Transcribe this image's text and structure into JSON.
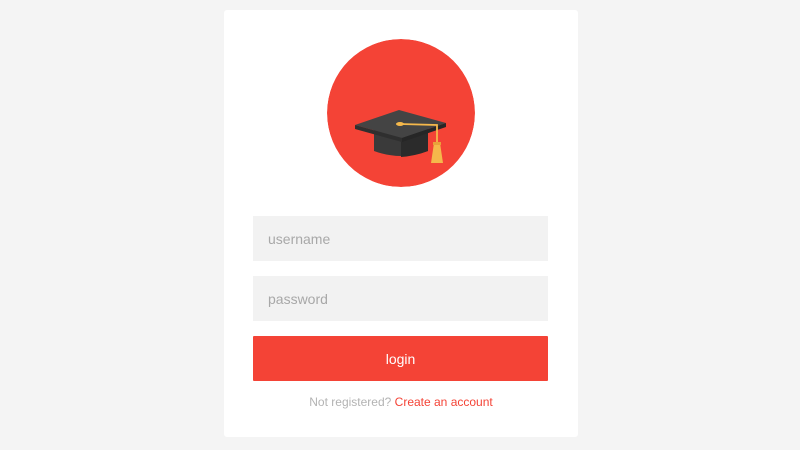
{
  "logo": {
    "icon": "graduation-cap-icon",
    "background_color": "#f44336",
    "cap_color": "#3a3a3a",
    "tassel_color": "#f5b84b"
  },
  "form": {
    "username_placeholder": "username",
    "username_value": "",
    "password_placeholder": "password",
    "password_value": "",
    "login_label": "login"
  },
  "footer": {
    "prompt": "Not registered?",
    "link": "Create an account"
  },
  "colors": {
    "accent": "#f44336",
    "page_background": "#f4f4f4",
    "card_background": "#ffffff",
    "field_background": "#f2f2f2"
  }
}
